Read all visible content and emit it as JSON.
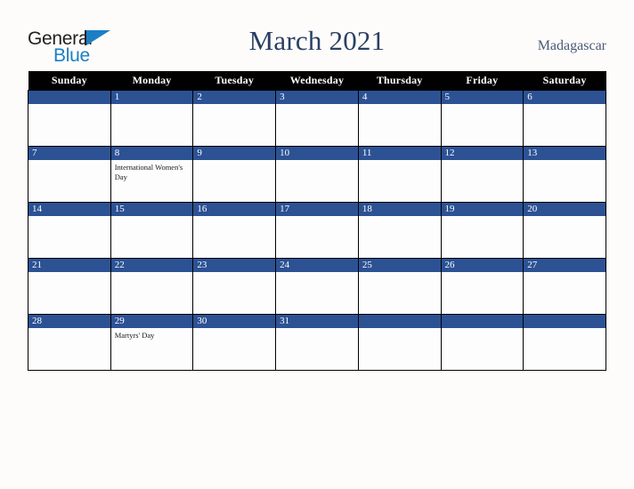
{
  "logo": {
    "word_one": "General",
    "word_two": "Blue",
    "triangle_color": "#1b7fc4",
    "word_one_color": "#231f20",
    "word_two_color": "#1b7fc4"
  },
  "header": {
    "title": "March 2021",
    "country": "Madagascar",
    "title_color": "#2b3f63",
    "country_color": "#4a5a75"
  },
  "theme": {
    "page_background": "#fdfcfb",
    "weekday_header_background": "#010101",
    "weekday_header_text": "#ffffff",
    "day_number_bar": "#2c5294",
    "day_number_text": "#ffffff",
    "cell_background": "#fdfdfd",
    "grid_line": "#000000"
  },
  "weekdays": [
    "Sunday",
    "Monday",
    "Tuesday",
    "Wednesday",
    "Thursday",
    "Friday",
    "Saturday"
  ],
  "weeks": [
    [
      {
        "day": "",
        "events": ""
      },
      {
        "day": "1",
        "events": ""
      },
      {
        "day": "2",
        "events": ""
      },
      {
        "day": "3",
        "events": ""
      },
      {
        "day": "4",
        "events": ""
      },
      {
        "day": "5",
        "events": ""
      },
      {
        "day": "6",
        "events": ""
      }
    ],
    [
      {
        "day": "7",
        "events": ""
      },
      {
        "day": "8",
        "events": "International Women's Day"
      },
      {
        "day": "9",
        "events": ""
      },
      {
        "day": "10",
        "events": ""
      },
      {
        "day": "11",
        "events": ""
      },
      {
        "day": "12",
        "events": ""
      },
      {
        "day": "13",
        "events": ""
      }
    ],
    [
      {
        "day": "14",
        "events": ""
      },
      {
        "day": "15",
        "events": ""
      },
      {
        "day": "16",
        "events": ""
      },
      {
        "day": "17",
        "events": ""
      },
      {
        "day": "18",
        "events": ""
      },
      {
        "day": "19",
        "events": ""
      },
      {
        "day": "20",
        "events": ""
      }
    ],
    [
      {
        "day": "21",
        "events": ""
      },
      {
        "day": "22",
        "events": ""
      },
      {
        "day": "23",
        "events": ""
      },
      {
        "day": "24",
        "events": ""
      },
      {
        "day": "25",
        "events": ""
      },
      {
        "day": "26",
        "events": ""
      },
      {
        "day": "27",
        "events": ""
      }
    ],
    [
      {
        "day": "28",
        "events": ""
      },
      {
        "day": "29",
        "events": "Martyrs' Day"
      },
      {
        "day": "30",
        "events": ""
      },
      {
        "day": "31",
        "events": ""
      },
      {
        "day": "",
        "events": ""
      },
      {
        "day": "",
        "events": ""
      },
      {
        "day": "",
        "events": ""
      }
    ]
  ]
}
